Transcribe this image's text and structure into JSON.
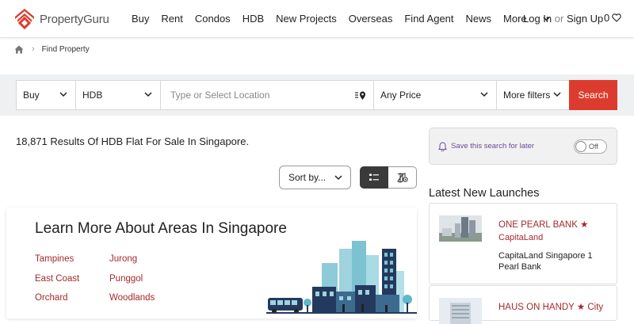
{
  "header": {
    "logo_text": "PropertyGuru",
    "nav": [
      "Buy",
      "Rent",
      "Condos",
      "HDB",
      "New Projects",
      "Overseas",
      "Find Agent",
      "News"
    ],
    "more_label": "More",
    "login_label": "Log In",
    "or_label": "or",
    "signup_label": "Sign Up",
    "favourites_count": "0"
  },
  "breadcrumb": {
    "current": "Find Property"
  },
  "search": {
    "listing_type": "Buy",
    "property_type": "HDB",
    "location_placeholder": "Type or Select Location",
    "price": "Any Price",
    "more_filters": "More filters",
    "search_label": "Search"
  },
  "results": {
    "summary": "18,871 Results Of HDB Flat For Sale In Singapore.",
    "sort_label": "Sort by..."
  },
  "areas": {
    "title": "Learn More About Areas In Singapore",
    "links": [
      "Tampines",
      "Jurong",
      "East Coast",
      "Punggol",
      "Orchard",
      "Woodlands"
    ]
  },
  "save_search": {
    "label": "Save this search for later",
    "toggle": "Off"
  },
  "launches": {
    "title": "Latest New Launches",
    "items": [
      {
        "name": "ONE PEARL BANK",
        "star": "★",
        "developer": "CapitaLand",
        "description": "CapitaLand Singapore 1 Pearl Bank"
      },
      {
        "name": "HAUS ON HANDY",
        "star": "★",
        "developer": "City",
        "description": ""
      }
    ]
  },
  "colors": {
    "brand_red": "#dc3c2e",
    "link_red": "#a52a2a",
    "save_purple": "#6a4aa0",
    "city_teal": "#5fb7c7",
    "city_navy": "#233a5e"
  },
  "icons": {
    "home": "home-icon",
    "location": "location-pin-icon",
    "list_view": "list-view-icon",
    "map_view": "map-view-icon",
    "bell": "bell-icon",
    "heart": "heart-icon"
  }
}
